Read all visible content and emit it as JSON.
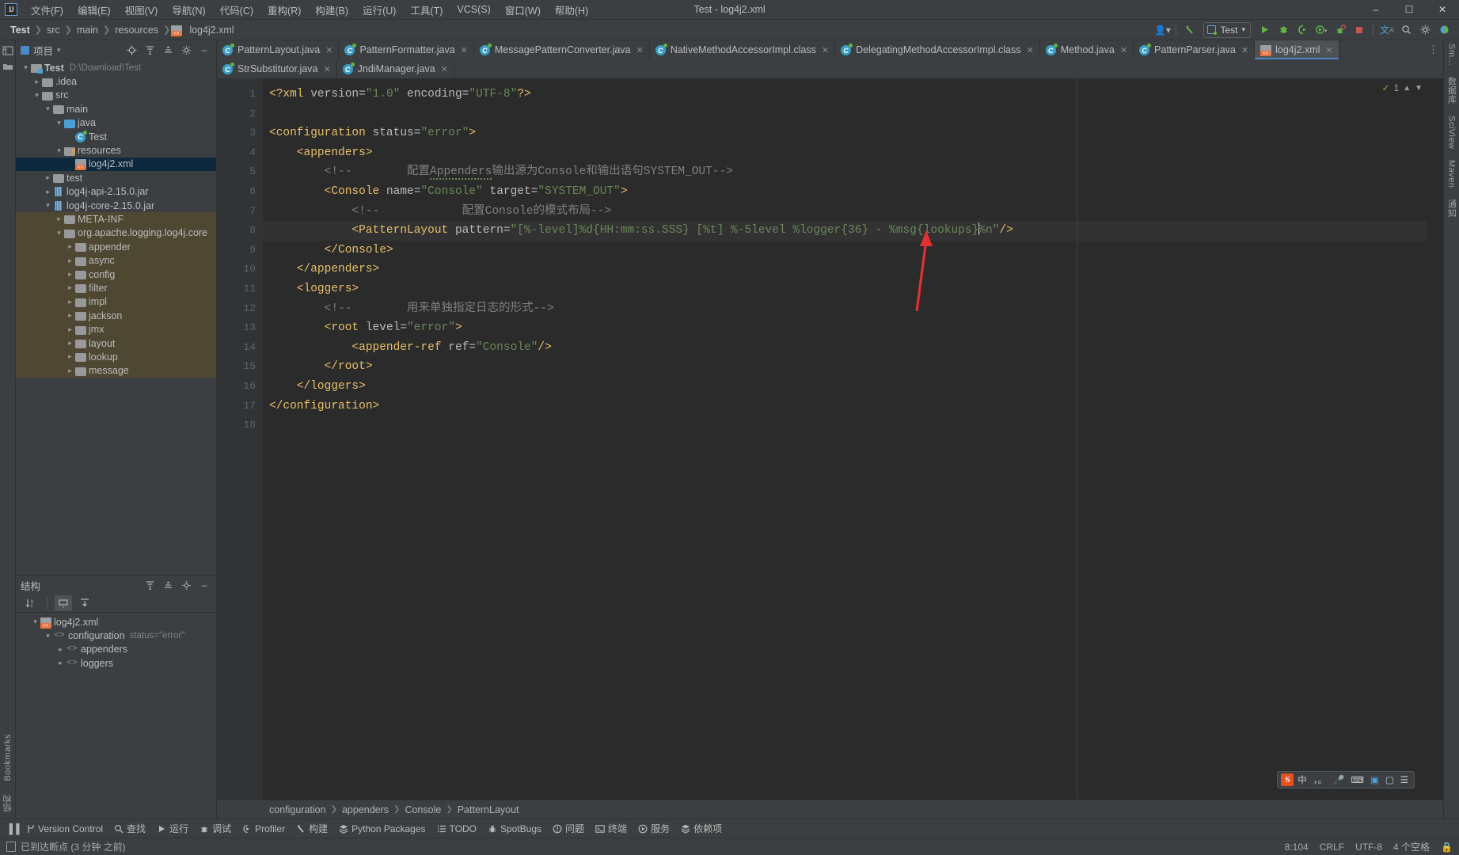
{
  "window": {
    "title": "Test - log4j2.xml",
    "logo": "IJ",
    "controls": [
      "minimize",
      "maximize",
      "close"
    ]
  },
  "menu": [
    {
      "label": "文件(F)"
    },
    {
      "label": "编辑(E)"
    },
    {
      "label": "视图(V)"
    },
    {
      "label": "导航(N)"
    },
    {
      "label": "代码(C)"
    },
    {
      "label": "重构(R)"
    },
    {
      "label": "构建(B)"
    },
    {
      "label": "运行(U)"
    },
    {
      "label": "工具(T)"
    },
    {
      "label": "VCS(S)"
    },
    {
      "label": "窗口(W)"
    },
    {
      "label": "帮助(H)"
    }
  ],
  "navbar": {
    "crumbs": [
      "Test",
      "src",
      "main",
      "resources",
      "log4j2.xml"
    ],
    "run_config": "Test",
    "icons": [
      "user-icon",
      "build-hammer-icon",
      "run-icon",
      "debug-icon",
      "run-with-coverage-icon",
      "profile-icon",
      "rerun-icon",
      "stop-icon",
      "translate-icon",
      "search-everywhere-icon",
      "settings-gear-icon",
      "theme-icon"
    ]
  },
  "project_panel": {
    "title": "项目",
    "actions": [
      "locate-icon",
      "expand-all-icon",
      "collapse-all-icon",
      "gear-icon",
      "hide-icon"
    ],
    "tree": [
      {
        "depth": 0,
        "arrow": "down",
        "icon": "module-icon",
        "label": "Test",
        "bold": true,
        "path": "D:\\Download\\Test"
      },
      {
        "depth": 1,
        "arrow": "right",
        "icon": "folder-icon",
        "label": ".idea"
      },
      {
        "depth": 1,
        "arrow": "down",
        "icon": "folder-icon",
        "label": "src"
      },
      {
        "depth": 2,
        "arrow": "down",
        "icon": "folder-icon",
        "label": "main"
      },
      {
        "depth": 3,
        "arrow": "down",
        "icon": "folder-blue-icon",
        "label": "java"
      },
      {
        "depth": 4,
        "arrow": "none",
        "icon": "class-icon",
        "label": "Test"
      },
      {
        "depth": 3,
        "arrow": "down",
        "icon": "folder-resources-icon",
        "label": "resources"
      },
      {
        "depth": 4,
        "arrow": "none",
        "icon": "xml-icon",
        "label": "log4j2.xml",
        "selected": true
      },
      {
        "depth": 2,
        "arrow": "right",
        "icon": "folder-icon",
        "label": "test"
      },
      {
        "depth": 2,
        "arrow": "right",
        "icon": "jar-icon",
        "label": "log4j-api-2.15.0.jar"
      },
      {
        "depth": 2,
        "arrow": "down",
        "icon": "jar-icon",
        "label": "log4j-core-2.15.0.jar"
      },
      {
        "depth": 3,
        "arrow": "right",
        "icon": "folder-icon",
        "label": "META-INF",
        "lib": true
      },
      {
        "depth": 3,
        "arrow": "down",
        "icon": "folder-icon",
        "label": "org.apache.logging.log4j.core",
        "lib": true
      },
      {
        "depth": 4,
        "arrow": "right",
        "icon": "folder-icon",
        "label": "appender",
        "lib": true
      },
      {
        "depth": 4,
        "arrow": "right",
        "icon": "folder-icon",
        "label": "async",
        "lib": true
      },
      {
        "depth": 4,
        "arrow": "right",
        "icon": "folder-icon",
        "label": "config",
        "lib": true
      },
      {
        "depth": 4,
        "arrow": "right",
        "icon": "folder-icon",
        "label": "filter",
        "lib": true
      },
      {
        "depth": 4,
        "arrow": "right",
        "icon": "folder-icon",
        "label": "impl",
        "lib": true
      },
      {
        "depth": 4,
        "arrow": "right",
        "icon": "folder-icon",
        "label": "jackson",
        "lib": true
      },
      {
        "depth": 4,
        "arrow": "right",
        "icon": "folder-icon",
        "label": "jmx",
        "lib": true
      },
      {
        "depth": 4,
        "arrow": "right",
        "icon": "folder-icon",
        "label": "layout",
        "lib": true
      },
      {
        "depth": 4,
        "arrow": "right",
        "icon": "folder-icon",
        "label": "lookup",
        "lib": true
      },
      {
        "depth": 4,
        "arrow": "right",
        "icon": "folder-icon",
        "label": "message",
        "lib": true
      }
    ]
  },
  "structure_panel": {
    "title": "结构",
    "toolbar_icons": [
      "sort-alphabetically-icon",
      "expand-all-icon",
      "collapse-all-icon",
      "gear-icon",
      "hide-icon"
    ],
    "tree": [
      {
        "depth": 0,
        "arrow": "down",
        "icon": "xml-icon",
        "label": "log4j2.xml"
      },
      {
        "depth": 1,
        "arrow": "down",
        "icon": "tag-icon",
        "label": "configuration",
        "attr": "status=\"error\""
      },
      {
        "depth": 2,
        "arrow": "right",
        "icon": "tag-icon",
        "label": "appenders"
      },
      {
        "depth": 2,
        "arrow": "right",
        "icon": "tag-icon",
        "label": "loggers"
      }
    ]
  },
  "editor": {
    "tabs_row1": [
      {
        "label": "PatternLayout.java",
        "icon": "java-class-icon",
        "active": false
      },
      {
        "label": "PatternFormatter.java",
        "icon": "java-class-icon",
        "active": false
      },
      {
        "label": "MessagePatternConverter.java",
        "icon": "java-class-icon",
        "active": false
      },
      {
        "label": "NativeMethodAccessorImpl.class",
        "icon": "java-class-icon",
        "active": false
      },
      {
        "label": "DelegatingMethodAccessorImpl.class",
        "icon": "java-class-icon",
        "active": false
      },
      {
        "label": "Method.java",
        "icon": "java-class-icon",
        "active": false
      },
      {
        "label": "PatternParser.java",
        "icon": "java-class-icon",
        "active": false
      },
      {
        "label": "log4j2.xml",
        "icon": "xml-icon",
        "active": true
      }
    ],
    "tabs_row2": [
      {
        "label": "StrSubstitutor.java",
        "icon": "java-class-icon",
        "active": false
      },
      {
        "label": "JndiManager.java",
        "icon": "java-class-icon",
        "active": false
      }
    ],
    "line_numbers": [
      "1",
      "2",
      "3",
      "4",
      "5",
      "6",
      "7",
      "8",
      "9",
      "10",
      "11",
      "12",
      "13",
      "14",
      "15",
      "16",
      "17",
      "18"
    ],
    "inspection_count": "1",
    "breadcrumbs": [
      "configuration",
      "appenders",
      "Console",
      "PatternLayout"
    ]
  },
  "ime": {
    "logo": "S",
    "items": [
      "中",
      "，。",
      "mic-icon",
      "keyboard-icon",
      "screenshot-icon",
      "box-icon",
      "menu-icon"
    ]
  },
  "toolwindows": [
    {
      "label": "Version Control",
      "icon": "vcs-branch-icon"
    },
    {
      "label": "查找",
      "icon": "search-icon"
    },
    {
      "label": "运行",
      "icon": "run-icon"
    },
    {
      "label": "调试",
      "icon": "debug-icon"
    },
    {
      "label": "Profiler",
      "icon": "profiler-icon"
    },
    {
      "label": "构建",
      "icon": "build-hammer-icon"
    },
    {
      "label": "Python Packages",
      "icon": "packages-icon"
    },
    {
      "label": "TODO",
      "icon": "todo-list-icon"
    },
    {
      "label": "SpotBugs",
      "icon": "bug-icon"
    },
    {
      "label": "问题",
      "icon": "problems-icon"
    },
    {
      "label": "终端",
      "icon": "terminal-icon"
    },
    {
      "label": "服务",
      "icon": "services-icon"
    },
    {
      "label": "依赖项",
      "icon": "dependencies-icon"
    }
  ],
  "status": {
    "message": "已到达断点 (3 分钟 之前)",
    "caret": "8:104",
    "line_sep": "CRLF",
    "encoding": "UTF-8",
    "indent": "4 个空格",
    "lock_icon": "lock-icon"
  },
  "left_rail": {
    "labels": [
      "Bookmarks",
      "结构"
    ],
    "icons": [
      "project-icon",
      "folder-icon"
    ]
  },
  "right_rail": {
    "labels": [
      "Sm...",
      "数据库",
      "SciView",
      "Maven",
      "通知"
    ]
  },
  "code_lines": [
    {
      "n": 1,
      "segs": [
        {
          "t": "tag",
          "v": "<?xml "
        },
        {
          "t": "attr",
          "v": "version="
        },
        {
          "t": "val",
          "v": "\"1.0\""
        },
        {
          "t": "attr",
          "v": " encoding="
        },
        {
          "t": "val",
          "v": "\"UTF-8\""
        },
        {
          "t": "tag",
          "v": "?>"
        }
      ],
      "indent": 0
    },
    {
      "n": 2,
      "segs": [],
      "indent": 0
    },
    {
      "n": 3,
      "segs": [
        {
          "t": "tag",
          "v": "<configuration "
        },
        {
          "t": "attr",
          "v": "status="
        },
        {
          "t": "val",
          "v": "\"error\""
        },
        {
          "t": "tag",
          "v": ">"
        }
      ],
      "indent": 0
    },
    {
      "n": 4,
      "segs": [
        {
          "t": "tag",
          "v": "<appenders>"
        }
      ],
      "indent": 1
    },
    {
      "n": 5,
      "segs": [
        {
          "t": "cmt",
          "v": "<!--        配置Appenders输出源为Console和输出语句SYSTEM_OUT-->"
        }
      ],
      "indent": 2
    },
    {
      "n": 6,
      "segs": [
        {
          "t": "tag",
          "v": "<Console "
        },
        {
          "t": "attr",
          "v": "name="
        },
        {
          "t": "val",
          "v": "\"Console\""
        },
        {
          "t": "attr",
          "v": " target="
        },
        {
          "t": "val",
          "v": "\"SYSTEM_OUT\""
        },
        {
          "t": "tag",
          "v": ">"
        }
      ],
      "indent": 2
    },
    {
      "n": 7,
      "segs": [
        {
          "t": "cmt",
          "v": "<!--            配置Console的模式布局-->"
        }
      ],
      "indent": 3
    },
    {
      "n": 8,
      "segs": [
        {
          "t": "tag",
          "v": "<PatternLayout "
        },
        {
          "t": "attr",
          "v": "pattern="
        },
        {
          "t": "val",
          "v": "\"[%-level]%d{HH:mm:ss.SSS} [%t] %-5level %logger{36} - %msg{lookups}"
        },
        {
          "t": "caret",
          "v": ""
        },
        {
          "t": "val",
          "v": "%n\""
        },
        {
          "t": "tag",
          "v": "/>"
        }
      ],
      "indent": 3,
      "highlight": true
    },
    {
      "n": 9,
      "segs": [
        {
          "t": "tag",
          "v": "</Console>"
        }
      ],
      "indent": 2
    },
    {
      "n": 10,
      "segs": [
        {
          "t": "tag",
          "v": "</appenders>"
        }
      ],
      "indent": 1
    },
    {
      "n": 11,
      "segs": [
        {
          "t": "tag",
          "v": "<loggers>"
        }
      ],
      "indent": 1
    },
    {
      "n": 12,
      "segs": [
        {
          "t": "cmt",
          "v": "<!--        用来单独指定日志的形式-->"
        }
      ],
      "indent": 2
    },
    {
      "n": 13,
      "segs": [
        {
          "t": "tag",
          "v": "<root "
        },
        {
          "t": "attr",
          "v": "level="
        },
        {
          "t": "val",
          "v": "\"error\""
        },
        {
          "t": "tag",
          "v": ">"
        }
      ],
      "indent": 2
    },
    {
      "n": 14,
      "segs": [
        {
          "t": "tag",
          "v": "<appender-ref "
        },
        {
          "t": "attr",
          "v": "ref="
        },
        {
          "t": "val",
          "v": "\"Console\""
        },
        {
          "t": "tag",
          "v": "/>"
        }
      ],
      "indent": 3
    },
    {
      "n": 15,
      "segs": [
        {
          "t": "tag",
          "v": "</root>"
        }
      ],
      "indent": 2
    },
    {
      "n": 16,
      "segs": [
        {
          "t": "tag",
          "v": "</loggers>"
        }
      ],
      "indent": 1
    },
    {
      "n": 17,
      "segs": [
        {
          "t": "tag",
          "v": "</configuration>"
        }
      ],
      "indent": 0
    },
    {
      "n": 18,
      "segs": [],
      "indent": 0
    }
  ],
  "colors": {
    "bg_panel": "#3c3f41",
    "bg_editor": "#2b2b2b",
    "accent_blue": "#4a88c7",
    "selection": "#0d293e",
    "library_bg": "#4e4833",
    "tag": "#e8bf6a",
    "value": "#6a8759",
    "comment": "#808080",
    "arrow_red": "#e03030"
  }
}
